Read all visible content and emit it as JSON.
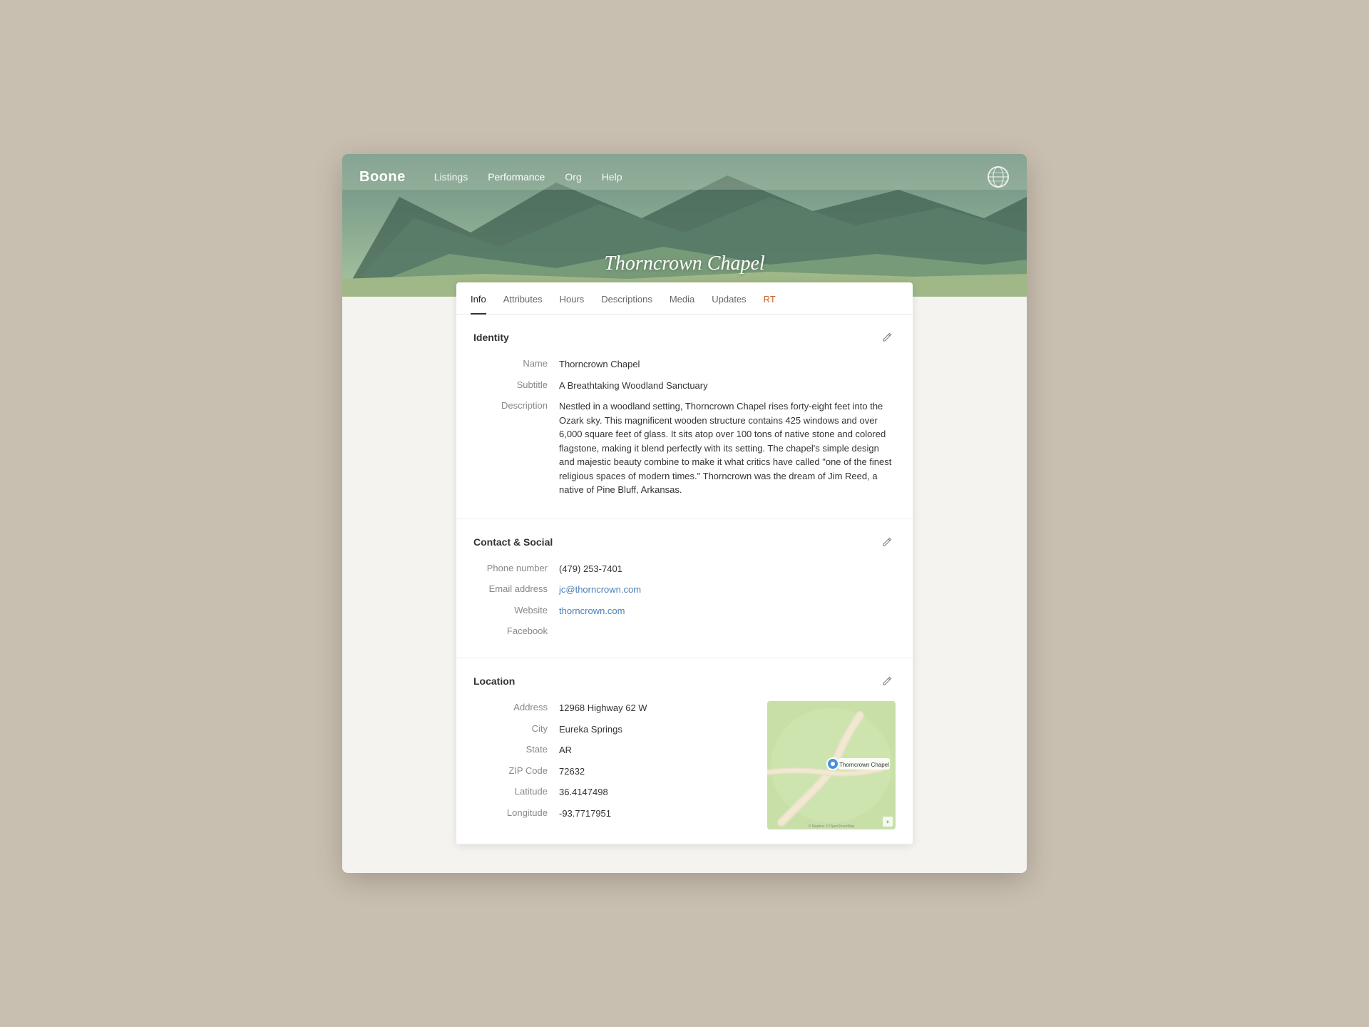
{
  "app": {
    "logo": "Boone",
    "nav_links": [
      {
        "label": "Listings",
        "active": false
      },
      {
        "label": "Performance",
        "active": false
      },
      {
        "label": "Org",
        "active": false
      },
      {
        "label": "Help",
        "active": false
      }
    ]
  },
  "hero": {
    "title": "Thorncrown Chapel"
  },
  "tabs": [
    {
      "label": "Info",
      "active": true
    },
    {
      "label": "Attributes",
      "active": false
    },
    {
      "label": "Hours",
      "active": false
    },
    {
      "label": "Descriptions",
      "active": false
    },
    {
      "label": "Media",
      "active": false
    },
    {
      "label": "Updates",
      "active": false
    },
    {
      "label": "RT",
      "active": false,
      "special": true
    }
  ],
  "identity": {
    "section_title": "Identity",
    "fields": [
      {
        "label": "Name",
        "value": "Thorncrown Chapel"
      },
      {
        "label": "Subtitle",
        "value": "A Breathtaking Woodland Sanctuary"
      },
      {
        "label": "Description",
        "value": "Nestled in a woodland setting, Thorncrown Chapel rises forty-eight feet into the Ozark sky. This magnificent wooden structure contains 425 windows and over 6,000 square feet of glass. It sits atop over 100 tons of native stone and colored flagstone, making it blend perfectly with its setting. The chapel's simple design and majestic beauty combine to make it what critics have called \"one of the finest religious spaces of modern times.\" Thorncrown was the dream of Jim Reed, a native of Pine Bluff, Arkansas."
      }
    ]
  },
  "contact": {
    "section_title": "Contact & Social",
    "fields": [
      {
        "label": "Phone number",
        "value": "(479) 253-7401",
        "is_link": false
      },
      {
        "label": "Email address",
        "value": "jc@thorncrown.com",
        "is_link": true
      },
      {
        "label": "Website",
        "value": "thorncrown.com",
        "is_link": true
      },
      {
        "label": "Facebook",
        "value": "",
        "is_link": false
      }
    ]
  },
  "location": {
    "section_title": "Location",
    "fields": [
      {
        "label": "Address",
        "value": "12968 Highway 62 W"
      },
      {
        "label": "City",
        "value": "Eureka Springs"
      },
      {
        "label": "State",
        "value": "AR"
      },
      {
        "label": "ZIP Code",
        "value": "72632"
      },
      {
        "label": "Latitude",
        "value": "36.4147498"
      },
      {
        "label": "Longitude",
        "value": "-93.7717951"
      }
    ],
    "map_label": "Thorncrown Chapel"
  },
  "icons": {
    "pencil": "✏",
    "globe": "🌐"
  }
}
